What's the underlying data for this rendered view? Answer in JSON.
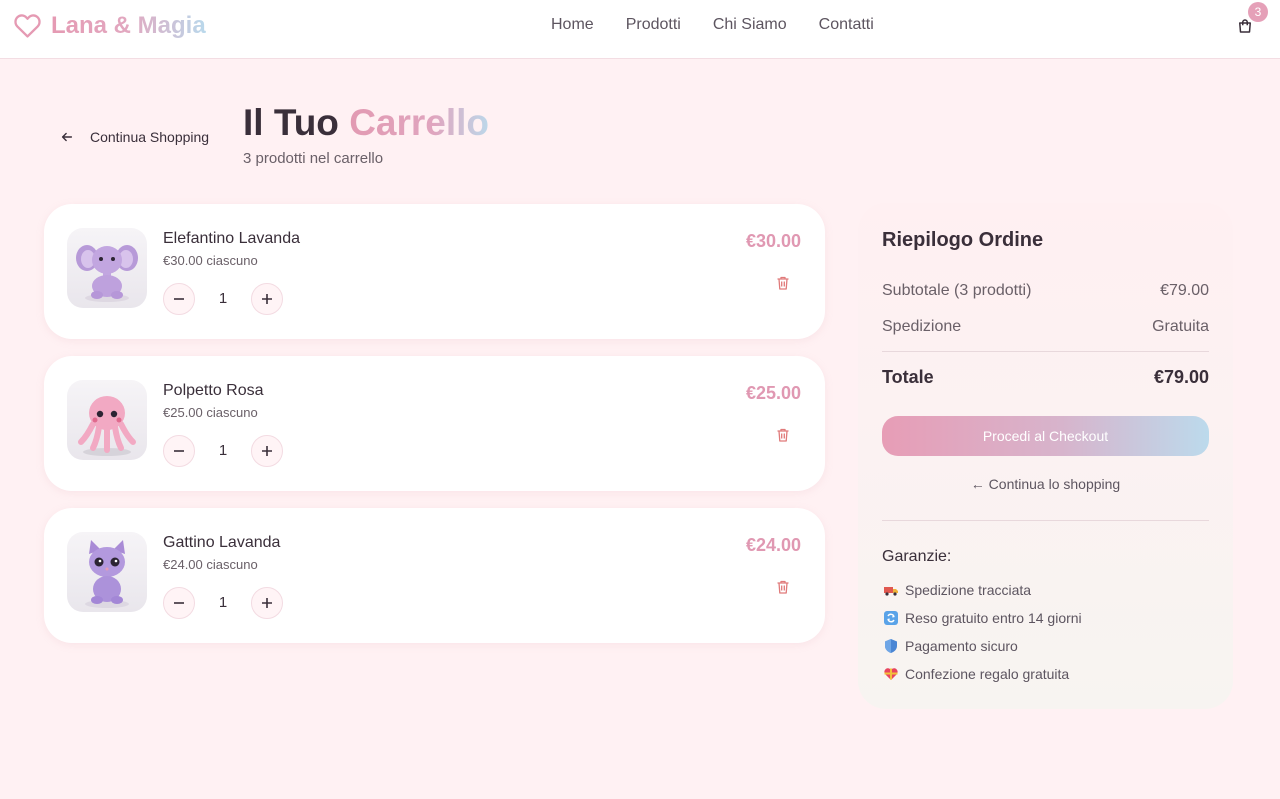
{
  "brand": {
    "name": "Lana & Magia",
    "icon": "heart-icon"
  },
  "nav": {
    "items": [
      "Home",
      "Prodotti",
      "Chi Siamo",
      "Contatti"
    ]
  },
  "cart": {
    "icon": "shopping-bag-icon",
    "badge": "3"
  },
  "header": {
    "back_label": "Continua Shopping",
    "title_main": "Il Tuo",
    "title_accent": "Carrello",
    "subtitle": "3 prodotti nel carrello"
  },
  "items": [
    {
      "name": "Elefantino Lavanda",
      "unit_price": "€30.00 ciascuno",
      "quantity": "1",
      "total": "€30.00",
      "image": "elephant-plush"
    },
    {
      "name": "Polpetto Rosa",
      "unit_price": "€25.00 ciascuno",
      "quantity": "1",
      "total": "€25.00",
      "image": "octopus-plush"
    },
    {
      "name": "Gattino Lavanda",
      "unit_price": "€24.00 ciascuno",
      "quantity": "1",
      "total": "€24.00",
      "image": "kitten-plush"
    }
  ],
  "summary": {
    "title": "Riepilogo Ordine",
    "subtotal_label": "Subtotale (3 prodotti)",
    "subtotal_value": "€79.00",
    "shipping_label": "Spedizione",
    "shipping_value": "Gratuita",
    "total_label": "Totale",
    "total_value": "€79.00",
    "checkout_label": "Procedi al Checkout",
    "continue_label": "← Continua lo shopping",
    "guarantees_title": "Garanzie:",
    "guarantees": [
      {
        "icon": "truck-icon",
        "text": "Spedizione tracciata"
      },
      {
        "icon": "refresh-icon",
        "text": "Reso gratuito entro 14 giorni"
      },
      {
        "icon": "shield-icon",
        "text": "Pagamento sicuro"
      },
      {
        "icon": "gift-heart-icon",
        "text": "Confezione regalo gratuita"
      }
    ]
  },
  "colors": {
    "accent_pink": "#e098b2",
    "accent_blue": "#bcdaec",
    "background": "#fff1f3",
    "trash": "#e07a7a"
  }
}
